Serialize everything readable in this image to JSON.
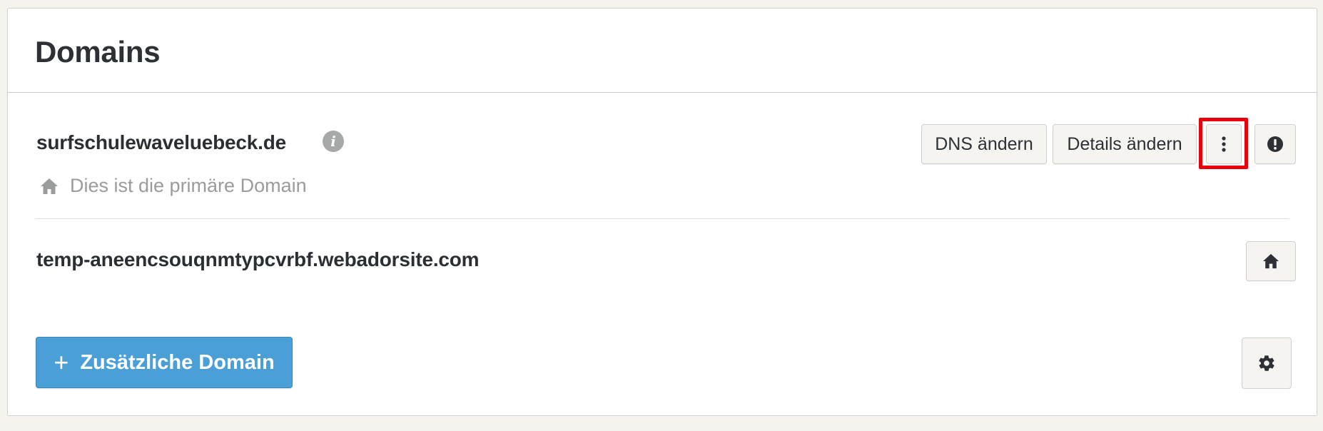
{
  "panel": {
    "title": "Domains"
  },
  "domains": [
    {
      "name": "surfschulewaveluebeck.de",
      "primary_note": "Dies ist die primäre Domain",
      "buttons": {
        "dns": "DNS ändern",
        "details": "Details ändern",
        "more_icon": "more-vertical-icon",
        "alert_icon": "alert-circle-icon"
      },
      "info_icon": "info-icon",
      "primary_icon": "home-icon"
    },
    {
      "name": "temp-aneencsouqnmtypcvrbf.webadorsite.com",
      "buttons": {
        "home_icon": "home-icon"
      }
    }
  ],
  "footer": {
    "add_domain_label": "Zusätzliche Domain",
    "add_icon": "plus-icon",
    "settings_icon": "gear-icon"
  },
  "colors": {
    "accent": "#4a9fd6",
    "highlight": "#e8000b",
    "muted_text": "#9a9c9c",
    "background": "#f4f3ee"
  }
}
